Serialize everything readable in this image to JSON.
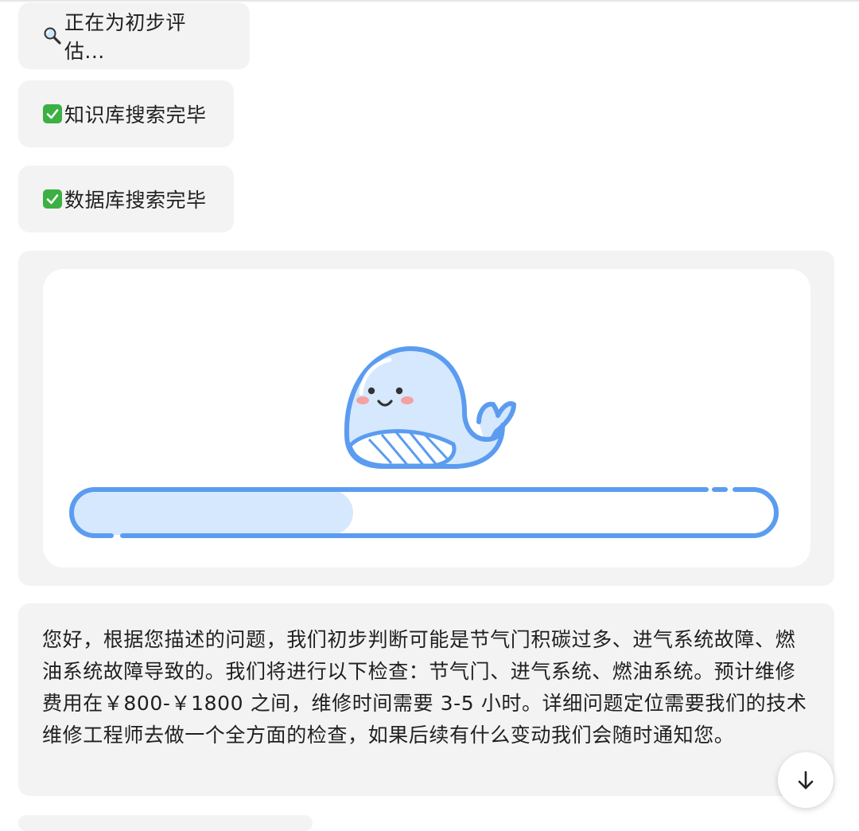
{
  "messages": {
    "status_1": {
      "icon": "magnifier-icon",
      "text": "正在为初步评估..."
    },
    "status_2": {
      "icon": "check-mark-icon",
      "text": "知识库搜索完毕"
    },
    "status_3": {
      "icon": "check-mark-icon",
      "text": "数据库搜索完毕"
    }
  },
  "progress": {
    "illustration": "whale-icon",
    "value": 0.4
  },
  "answer": {
    "text": "您好，根据您描述的问题，我们初步判断可能是节气门积碳过多、进气系统故障、燃油系统故障导致的。我们将进行以下检查：节气门、进气系统、燃油系统。预计维修费用在￥800-￥1800 之间，维修时间需要 3-5 小时。详细问题定位需要我们的技术维修工程师去做一个全方面的检查，如果后续有什么变动我们会随时通知您。"
  },
  "scroll_button": {
    "icon": "arrow-down-icon"
  },
  "colors": {
    "bubble": "#f3f3f3",
    "accent": "#5b9cf0",
    "fill": "#d6e8fd",
    "check": "#3cb043"
  }
}
